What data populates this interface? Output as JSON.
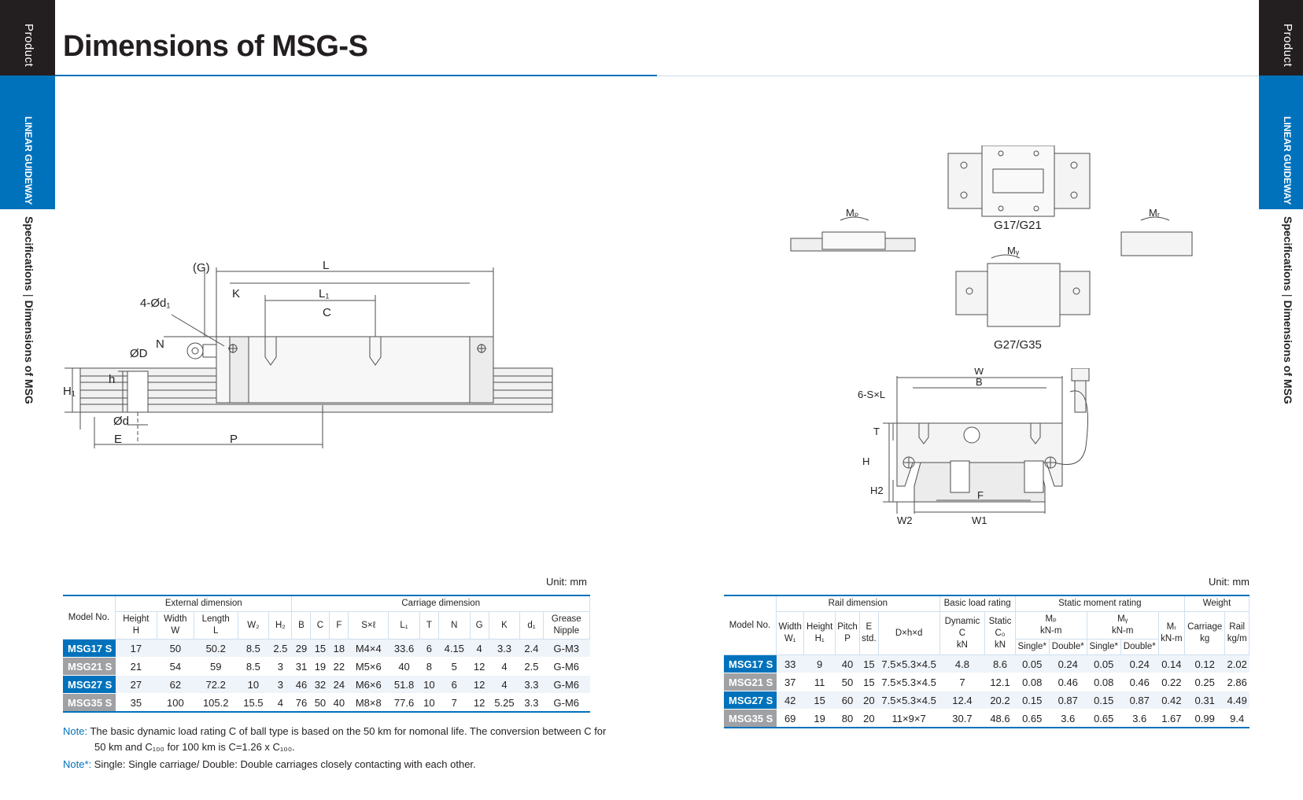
{
  "sidebar": {
    "product": "Product",
    "section": "LINEAR GUIDEWAY",
    "crumb_a": "Specifications",
    "crumb_b": "Dimensions of MSG"
  },
  "title": "Dimensions of MSG-S",
  "drawing_labels": {
    "G": "(G)",
    "L": "L",
    "K": "K",
    "L1": "L₁",
    "d1": "4-Ød₁",
    "C": "C",
    "N": "N",
    "D": "ØD",
    "h": "h",
    "H1": "H₁",
    "d": "Ød",
    "E": "E",
    "P": "P",
    "Mp": "Mₚ",
    "My": "Mᵧ",
    "Mr": "Mᵣ",
    "g1721": "G17/G21",
    "g2735": "G27/G35",
    "W": "W",
    "B": "B",
    "SxL": "6-S×L",
    "T": "T",
    "H": "H",
    "H2": "H2",
    "F": "F",
    "W2": "W2",
    "W1": "W1"
  },
  "left_table": {
    "unit": "Unit: mm",
    "model_header": "Model No.",
    "group_ext": "External dimension",
    "group_car": "Carriage dimension",
    "cols": [
      [
        "Height",
        "H"
      ],
      [
        "Width",
        "W"
      ],
      [
        "Length",
        "L"
      ],
      [
        "W₂",
        ""
      ],
      [
        "H₂",
        ""
      ],
      [
        "B",
        ""
      ],
      [
        "C",
        ""
      ],
      [
        "F",
        ""
      ],
      [
        "S×ℓ",
        ""
      ],
      [
        "L₁",
        ""
      ],
      [
        "T",
        ""
      ],
      [
        "N",
        ""
      ],
      [
        "G",
        ""
      ],
      [
        "K",
        ""
      ],
      [
        "d₁",
        ""
      ],
      [
        "Grease",
        "Nipple"
      ]
    ],
    "rows": [
      [
        "MSG17 S",
        "17",
        "50",
        "50.2",
        "8.5",
        "2.5",
        "29",
        "15",
        "18",
        "M4×4",
        "33.6",
        "6",
        "4.15",
        "4",
        "3.3",
        "2.4",
        "G-M3"
      ],
      [
        "MSG21 S",
        "21",
        "54",
        "59",
        "8.5",
        "3",
        "31",
        "19",
        "22",
        "M5×6",
        "40",
        "8",
        "5",
        "12",
        "4",
        "2.5",
        "G-M6"
      ],
      [
        "MSG27 S",
        "27",
        "62",
        "72.2",
        "10",
        "3",
        "46",
        "32",
        "24",
        "M6×6",
        "51.8",
        "10",
        "6",
        "12",
        "4",
        "3.3",
        "G-M6"
      ],
      [
        "MSG35 S",
        "35",
        "100",
        "105.2",
        "15.5",
        "4",
        "76",
        "50",
        "40",
        "M8×8",
        "77.6",
        "10",
        "7",
        "12",
        "5.25",
        "3.3",
        "G-M6"
      ]
    ]
  },
  "right_table": {
    "unit": "Unit: mm",
    "model_header": "Model No.",
    "group_rail": "Rail dimension",
    "group_load": "Basic load rating",
    "group_moment": "Static moment rating",
    "group_weight": "Weight",
    "rail_cols": [
      [
        "Width",
        "W₁"
      ],
      [
        "Height",
        "H₁"
      ],
      [
        "Pitch",
        "P"
      ],
      [
        "E",
        "std."
      ],
      [
        "D×h×d",
        ""
      ]
    ],
    "load_cols": [
      [
        "Dynamic",
        "C",
        "kN"
      ],
      [
        "Static",
        "C₀",
        "kN"
      ]
    ],
    "moment_cols": [
      [
        "Mₚ",
        "kN-m"
      ],
      [
        "Mᵧ",
        "kN-m"
      ],
      [
        "Mᵣ",
        "kN-m"
      ]
    ],
    "single": "Single*",
    "double": "Double*",
    "weight_cols": [
      [
        "Carriage",
        "kg"
      ],
      [
        "Rail",
        "kg/m"
      ]
    ],
    "rows": [
      [
        "MSG17 S",
        "33",
        "9",
        "40",
        "15",
        "7.5×5.3×4.5",
        "4.8",
        "8.6",
        "0.05",
        "0.24",
        "0.05",
        "0.24",
        "0.14",
        "0.12",
        "2.02"
      ],
      [
        "MSG21 S",
        "37",
        "11",
        "50",
        "15",
        "7.5×5.3×4.5",
        "7",
        "12.1",
        "0.08",
        "0.46",
        "0.08",
        "0.46",
        "0.22",
        "0.25",
        "2.86"
      ],
      [
        "MSG27 S",
        "42",
        "15",
        "60",
        "20",
        "7.5×5.3×4.5",
        "12.4",
        "20.2",
        "0.15",
        "0.87",
        "0.15",
        "0.87",
        "0.42",
        "0.31",
        "4.49"
      ],
      [
        "MSG35 S",
        "69",
        "19",
        "80",
        "20",
        "11×9×7",
        "30.7",
        "48.6",
        "0.65",
        "3.6",
        "0.65",
        "3.6",
        "1.67",
        "0.99",
        "9.4"
      ]
    ]
  },
  "notes": {
    "note1_label": "Note:",
    "note1_text": "The basic dynamic load rating C of ball type is based on the 50 km for nomonal life. The conversion between C for",
    "note1_text2": "50 km and C₁₀₀ for 100 km is C=1.26 x C₁₀₀.",
    "note2_label": "Note*:",
    "note2_text": "Single: Single carriage/ Double: Double carriages closely contacting with each other."
  }
}
